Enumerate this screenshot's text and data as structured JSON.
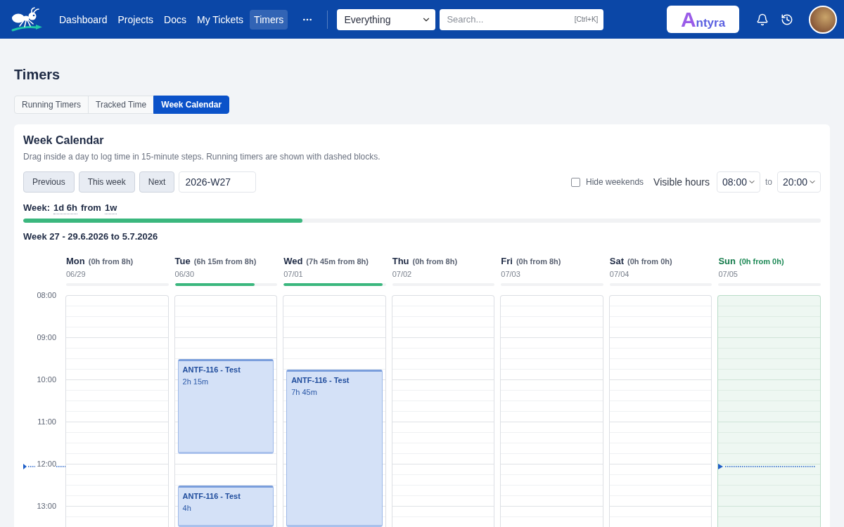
{
  "topbar": {
    "nav": [
      {
        "label": "Dashboard",
        "selected": false
      },
      {
        "label": "Projects",
        "selected": false
      },
      {
        "label": "Docs",
        "selected": false
      },
      {
        "label": "My Tickets",
        "selected": false
      },
      {
        "label": "Timers",
        "selected": true
      }
    ],
    "scope_select": {
      "value": "Everything"
    },
    "search": {
      "placeholder": "Search...",
      "shortcut": "[Ctrl+K]"
    },
    "brand": "Antyra"
  },
  "page_title": "Timers",
  "tabs": [
    {
      "label": "Running Timers",
      "selected": false
    },
    {
      "label": "Tracked Time",
      "selected": false
    },
    {
      "label": "Week Calendar",
      "selected": true
    }
  ],
  "calendar": {
    "title": "Week Calendar",
    "description": "Drag inside a day to log time in 15-minute steps. Running timers are shown with dashed blocks.",
    "buttons": [
      "Previous",
      "This week",
      "Next"
    ],
    "week_input": {
      "value": "2026-W27"
    },
    "hide_weekends": {
      "label": "Hide weekends",
      "checked": false
    },
    "visible_hours": {
      "label": "Visible hours",
      "from": "08:00",
      "separator": "to",
      "to": "20:00"
    },
    "week_summary": {
      "label": "Week:",
      "tracked": "1d 6h",
      "connector": "from",
      "target": "1w",
      "level": 0.35
    },
    "range_title": "Week 27 - 29.6.2026 to 5.7.2026",
    "hours": [
      "08:00",
      "09:00",
      "10:00",
      "11:00",
      "12:00",
      "13:00"
    ],
    "days": [
      {
        "name": "Mon",
        "total": "(0h from 8h)",
        "date": "06/29",
        "today": false
      },
      {
        "name": "Tue",
        "total": "(6h 15m from 8h)",
        "date": "06/30",
        "level": 0.78,
        "today": false,
        "entries": [
          {
            "title": "ANTF-116 - Test",
            "duration": "2h 15m"
          },
          {
            "title": "ANTF-116 - Test",
            "duration": "4h"
          }
        ]
      },
      {
        "name": "Wed",
        "total": "(7h 45m from 8h)",
        "date": "07/01",
        "level": 0.97,
        "today": false,
        "entries": [
          {
            "title": "ANTF-116 - Test",
            "duration": "7h 45m"
          }
        ]
      },
      {
        "name": "Thu",
        "total": "(0h from 8h)",
        "date": "07/02",
        "today": false
      },
      {
        "name": "Fri",
        "total": "(0h from 8h)",
        "date": "07/03",
        "today": false
      },
      {
        "name": "Sat",
        "total": "(0h from 0h)",
        "date": "07/04",
        "today": false
      },
      {
        "name": "Sun",
        "total": "(0h from 0h)",
        "date": "07/05",
        "today": true
      }
    ]
  }
}
